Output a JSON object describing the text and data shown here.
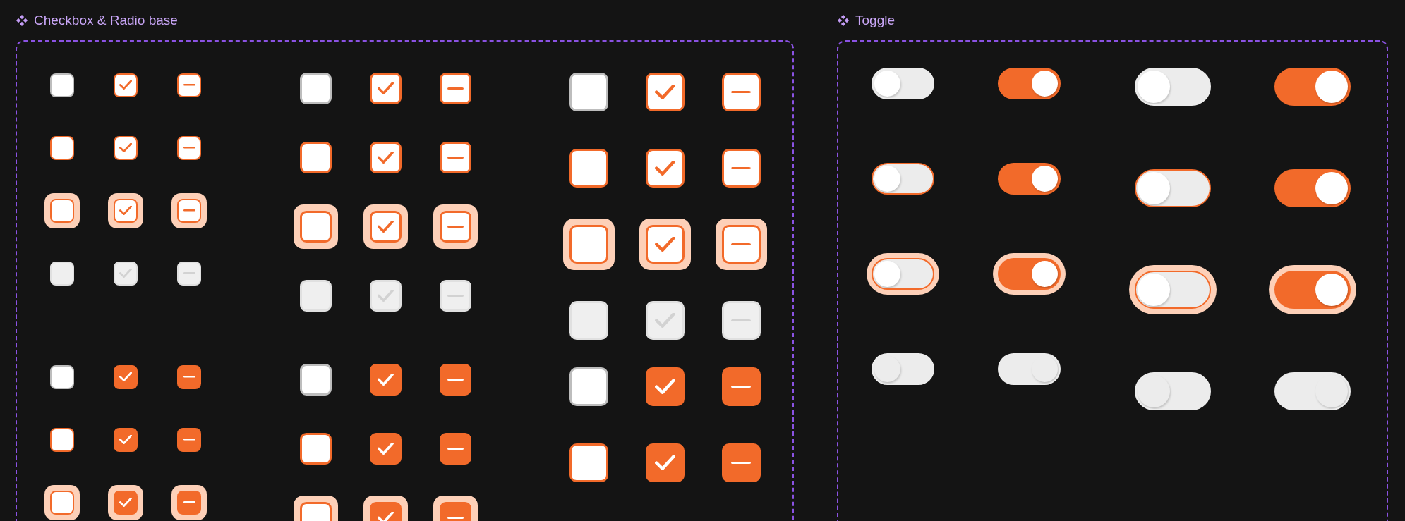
{
  "checkbox_panel": {
    "title": "Checkbox & Radio base",
    "groups": [
      {
        "rows": [
          {
            "kind": "default",
            "items": [
              {
                "kind": "check",
                "checked": false
              },
              {
                "kind": "check",
                "checked": true
              },
              {
                "kind": "dash",
                "checked": true
              }
            ]
          },
          {
            "kind": "hover",
            "items": [
              {
                "kind": "check",
                "checked": false
              },
              {
                "kind": "check",
                "checked": true
              },
              {
                "kind": "dash",
                "checked": true
              }
            ]
          },
          {
            "kind": "focus",
            "items": [
              {
                "kind": "check",
                "checked": false
              },
              {
                "kind": "check",
                "checked": true
              },
              {
                "kind": "dash",
                "checked": true
              }
            ]
          },
          {
            "kind": "disabled",
            "items": [
              {
                "kind": "check",
                "checked": false
              },
              {
                "kind": "check",
                "checked": true
              },
              {
                "kind": "dash",
                "checked": true
              }
            ]
          },
          {
            "kind": "default",
            "items": [
              {
                "kind": "check",
                "checked": false
              },
              {
                "kind": "check",
                "checked": true
              },
              {
                "kind": "dash",
                "checked": true
              }
            ]
          },
          {
            "kind": "hover",
            "items": [
              {
                "kind": "check",
                "checked": false
              },
              {
                "kind": "check",
                "checked": true
              },
              {
                "kind": "dash",
                "checked": true
              }
            ]
          },
          {
            "kind": "focus",
            "items": [
              {
                "kind": "check",
                "checked": false
              },
              {
                "kind": "check",
                "checked": true
              },
              {
                "kind": "dash",
                "checked": true
              }
            ]
          }
        ]
      },
      {
        "rows": [
          {
            "kind": "default",
            "items": [
              {
                "kind": "check",
                "checked": false
              },
              {
                "kind": "check",
                "checked": true
              },
              {
                "kind": "dash",
                "checked": true
              }
            ]
          },
          {
            "kind": "hover",
            "items": [
              {
                "kind": "check",
                "checked": false
              },
              {
                "kind": "check",
                "checked": true
              },
              {
                "kind": "dash",
                "checked": true
              }
            ]
          },
          {
            "kind": "focus",
            "items": [
              {
                "kind": "check",
                "checked": false
              },
              {
                "kind": "check",
                "checked": true
              },
              {
                "kind": "dash",
                "checked": true
              }
            ]
          },
          {
            "kind": "disabled",
            "items": [
              {
                "kind": "check",
                "checked": false
              },
              {
                "kind": "check",
                "checked": true
              },
              {
                "kind": "dash",
                "checked": true
              }
            ]
          },
          {
            "kind": "default",
            "items": [
              {
                "kind": "check",
                "checked": false
              },
              {
                "kind": "check",
                "checked": true
              },
              {
                "kind": "dash",
                "checked": true
              }
            ]
          },
          {
            "kind": "hover",
            "items": [
              {
                "kind": "check",
                "checked": false
              },
              {
                "kind": "check",
                "checked": true
              },
              {
                "kind": "dash",
                "checked": true
              }
            ]
          },
          {
            "kind": "focus",
            "items": [
              {
                "kind": "check",
                "checked": false
              },
              {
                "kind": "check",
                "checked": true
              },
              {
                "kind": "dash",
                "checked": true
              }
            ]
          }
        ]
      },
      {
        "rows": [
          {
            "kind": "default",
            "items": [
              {
                "kind": "check",
                "checked": false
              },
              {
                "kind": "check",
                "checked": true
              },
              {
                "kind": "dash",
                "checked": true
              }
            ]
          },
          {
            "kind": "hover",
            "items": [
              {
                "kind": "check",
                "checked": false
              },
              {
                "kind": "check",
                "checked": true
              },
              {
                "kind": "dash",
                "checked": true
              }
            ]
          },
          {
            "kind": "focus",
            "items": [
              {
                "kind": "check",
                "checked": false
              },
              {
                "kind": "check",
                "checked": true
              },
              {
                "kind": "dash",
                "checked": true
              }
            ]
          },
          {
            "kind": "disabled",
            "items": [
              {
                "kind": "check",
                "checked": false
              },
              {
                "kind": "check",
                "checked": true
              },
              {
                "kind": "dash",
                "checked": true
              }
            ]
          },
          {
            "kind": "default",
            "items": [
              {
                "kind": "check",
                "checked": false
              },
              {
                "kind": "check",
                "checked": true
              },
              {
                "kind": "dash",
                "checked": true
              }
            ]
          },
          {
            "kind": "hover",
            "items": [
              {
                "kind": "check",
                "checked": false
              },
              {
                "kind": "check",
                "checked": true
              },
              {
                "kind": "dash",
                "checked": true
              }
            ]
          }
        ]
      }
    ]
  },
  "toggle_panel": {
    "title": "Toggle",
    "groups": [
      {
        "rows": [
          {
            "kind": "default",
            "items": [
              {
                "on": false
              },
              {
                "on": true
              }
            ]
          },
          {
            "kind": "hover",
            "items": [
              {
                "on": false
              },
              {
                "on": true
              }
            ]
          },
          {
            "kind": "focus",
            "items": [
              {
                "on": false
              },
              {
                "on": true
              }
            ]
          },
          {
            "kind": "disabled",
            "items": [
              {
                "on": false
              },
              {
                "on": true
              }
            ]
          }
        ]
      },
      {
        "rows": [
          {
            "kind": "default",
            "items": [
              {
                "on": false
              },
              {
                "on": true
              }
            ]
          },
          {
            "kind": "hover",
            "items": [
              {
                "on": false
              },
              {
                "on": true
              }
            ]
          },
          {
            "kind": "focus",
            "items": [
              {
                "on": false
              },
              {
                "on": true
              }
            ]
          },
          {
            "kind": "disabled",
            "items": [
              {
                "on": false
              },
              {
                "on": true
              }
            ]
          }
        ]
      }
    ]
  }
}
